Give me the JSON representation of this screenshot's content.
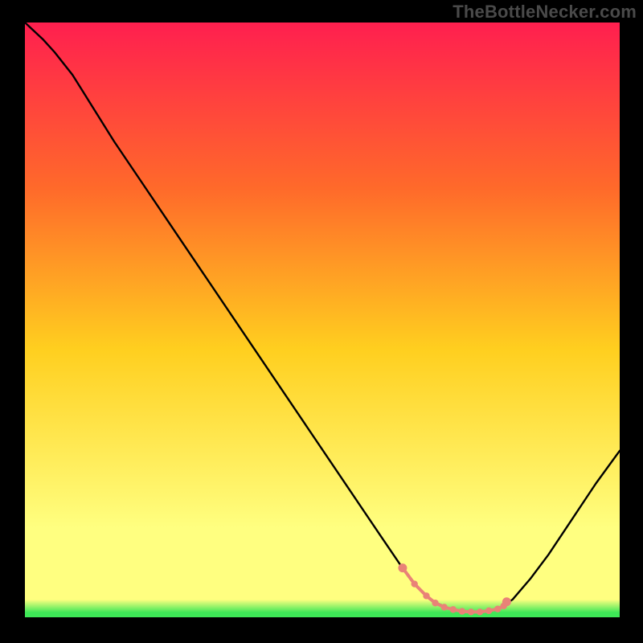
{
  "watermark": "TheBottleNecker.com",
  "colors": {
    "frame": "#000000",
    "gradient_top": "#ff1f4f",
    "gradient_mid1": "#ff6a2a",
    "gradient_mid2": "#ffcf1f",
    "gradient_low": "#ffff80",
    "gradient_min": "#3ee857",
    "curve": "#000000",
    "markers": "#e98277"
  },
  "chart_data": {
    "type": "line",
    "title": "",
    "xlabel": "",
    "ylabel": "",
    "xlim": [
      0,
      100
    ],
    "ylim": [
      0,
      100
    ],
    "x": [
      0,
      3,
      5,
      8,
      10,
      12.5,
      15,
      20,
      25,
      30,
      35,
      40,
      45,
      50,
      55,
      60,
      63,
      65,
      67,
      69,
      71,
      73,
      75,
      77,
      79,
      80,
      82,
      85,
      88,
      92,
      96,
      100
    ],
    "values": [
      100,
      97.2,
      95.0,
      91.2,
      88.0,
      84.0,
      80.0,
      72.6,
      65.2,
      57.8,
      50.4,
      43.0,
      35.6,
      28.2,
      20.8,
      13.4,
      9.0,
      6.2,
      4.0,
      2.5,
      1.6,
      1.1,
      0.9,
      0.9,
      1.2,
      1.6,
      3.0,
      6.5,
      10.5,
      16.5,
      22.5,
      28.0
    ],
    "markers": {
      "x": [
        63.5,
        65.5,
        67.5,
        69.0,
        70.5,
        72.0,
        73.5,
        75.0,
        76.5,
        78.0,
        79.5,
        80.5,
        81.0
      ],
      "values": [
        8.3,
        5.6,
        3.6,
        2.4,
        1.7,
        1.3,
        1.0,
        0.9,
        0.9,
        1.1,
        1.4,
        1.9,
        2.6
      ]
    },
    "annotations": []
  }
}
